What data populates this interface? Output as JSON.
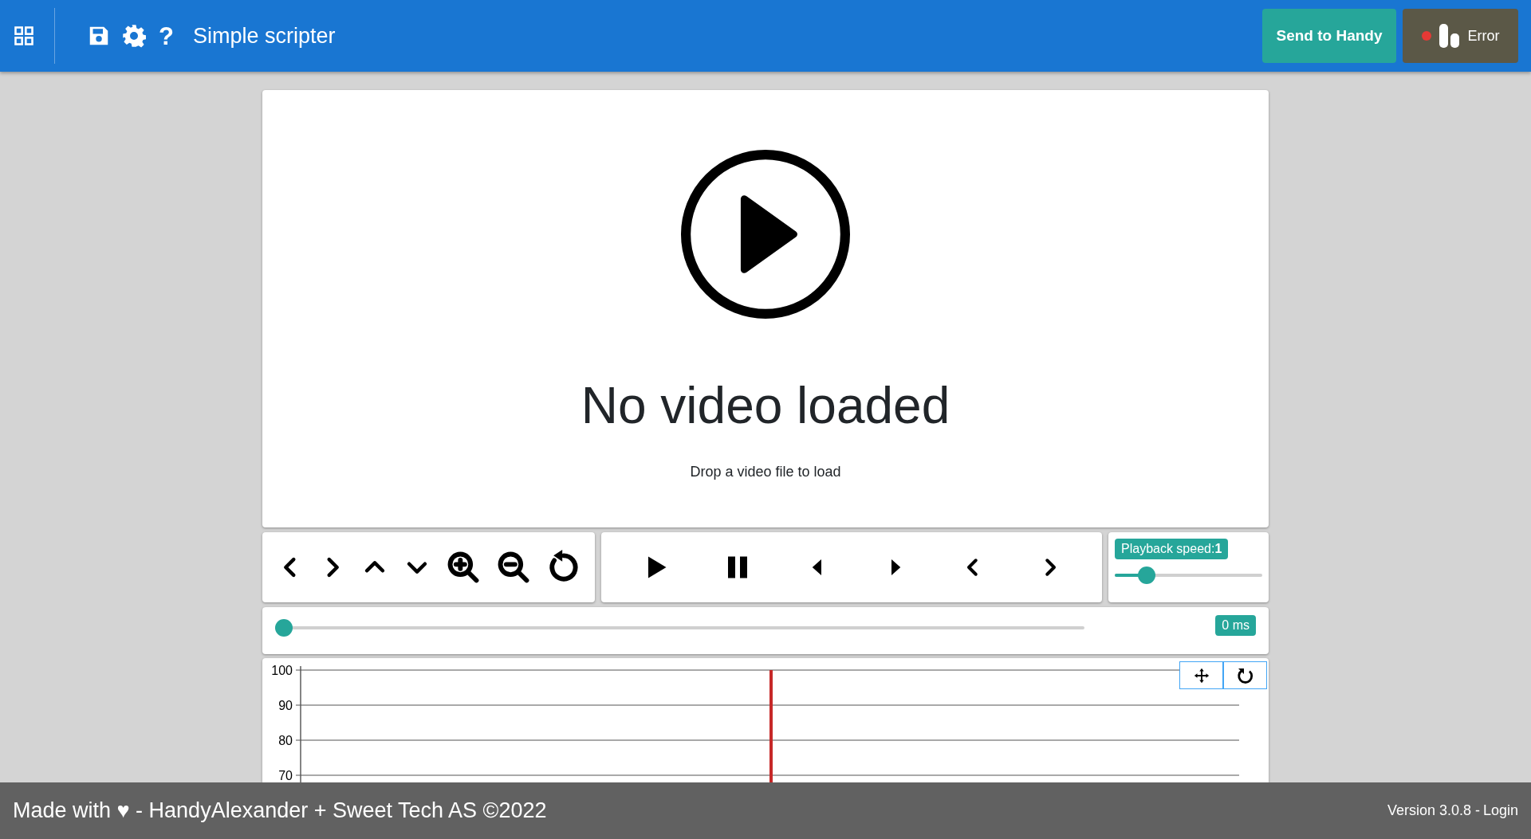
{
  "header": {
    "title": "Simple scripter",
    "help": "?",
    "send_button": "Send to Handy",
    "device": {
      "status": "Error",
      "connected": false
    }
  },
  "video": {
    "title": "No video loaded",
    "hint": "Drop a video file to load"
  },
  "playback_speed": {
    "label": "Playback speed:**1**",
    "level": 0.18
  },
  "timeline": {
    "level": 0,
    "reading": "0 ms"
  },
  "chart": {
    "y_axis_labels": [
      "100",
      "90",
      "80",
      "70"
    ]
  },
  "footer": {
    "credit": "Made with ♥ - HandyAlexander + Sweet Tech AS ©2022",
    "version": "Version 3.0.8 -",
    "login": "Login"
  }
}
